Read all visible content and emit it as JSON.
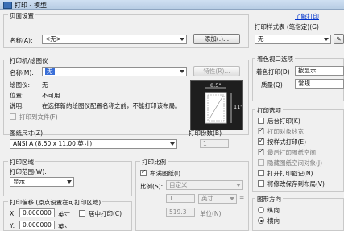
{
  "window": {
    "title": "打印 - 模型"
  },
  "help_link": "了解打印",
  "page_setup": {
    "header": "页面设置",
    "name_label": "名称(A):",
    "name_value": "<无>",
    "add_button": "添加(.)..."
  },
  "printer": {
    "header": "打印机/绘图仪",
    "name_label": "名称(M):",
    "name_value": "无",
    "properties_button": "特性(R)...",
    "plotter_label": "绘图仪:",
    "plotter_value": "无",
    "location_label": "位置:",
    "location_value": "不可用",
    "description_label": "说明:",
    "description_value": "在选择新的绘图仪配置名称之前，不能打印该布局。",
    "print_to_file_label": "打印到文件(F)",
    "preview_width": "8.5\"",
    "preview_height": "11\""
  },
  "paper_size": {
    "header": "图纸尺寸(Z)",
    "value": "ANSI A (8.50 x 11.00 英寸)"
  },
  "copies": {
    "header": "打印份数(B)",
    "value": "1"
  },
  "plot_area": {
    "header": "打印区域",
    "range_label": "打印范围(W):",
    "range_value": "显示"
  },
  "plot_offset": {
    "header": "打印偏移 (原点设置在可打印区域)",
    "x_label": "X:",
    "x_value": "0.000000",
    "x_unit": "英寸",
    "y_label": "Y:",
    "y_value": "0.000000",
    "y_unit": "英寸",
    "center_label": "居中打印(C)"
  },
  "plot_scale": {
    "header": "打印比例",
    "fit_label": "布满图纸(I)",
    "scale_label": "比例(S):",
    "scale_value": "自定义",
    "value1": "1",
    "unit1": "英寸",
    "value2": "519.3",
    "unit2": "单位(N)"
  },
  "plot_style_table": {
    "header": "打印样式表 (笔指定)(G)",
    "value": "无"
  },
  "shaded_viewport": {
    "header": "着色视口选项",
    "shade_label": "着色打印(D)",
    "shade_value": "按显示",
    "quality_label": "质量(Q)",
    "quality_value": "常规"
  },
  "plot_options": {
    "header": "打印选项",
    "items": [
      {
        "label": "后台打印(K)",
        "checked": false,
        "disabled": false
      },
      {
        "label": "打印对象线宽",
        "checked": true,
        "disabled": true
      },
      {
        "label": "按样式打印(E)",
        "checked": true,
        "disabled": false
      },
      {
        "label": "最后打印图纸空间",
        "checked": true,
        "disabled": true
      },
      {
        "label": "隐藏图纸空间对象(J)",
        "checked": false,
        "disabled": true
      },
      {
        "label": "打开打印戳记(N)",
        "checked": false,
        "disabled": false
      },
      {
        "label": "将修改保存到布局(V)",
        "checked": false,
        "disabled": false
      }
    ]
  },
  "orientation": {
    "header": "图形方向",
    "portrait_label": "纵向",
    "landscape_label": "横向"
  }
}
